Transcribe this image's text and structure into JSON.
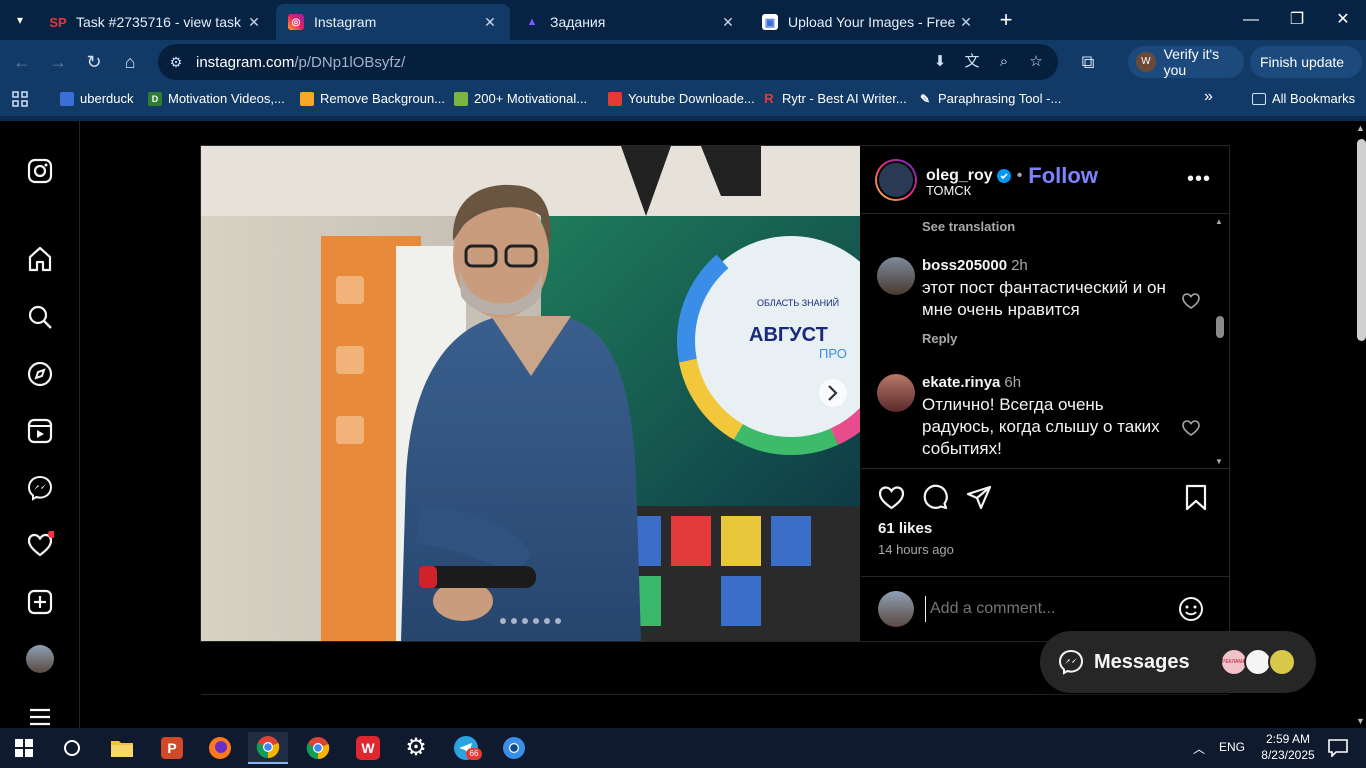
{
  "browser": {
    "tabs": [
      {
        "title": "Task #2735716 - view task",
        "icon": "sp-icon"
      },
      {
        "title": "Instagram",
        "icon": "instagram-icon"
      },
      {
        "title": "Задания",
        "icon": "zadaniya-icon"
      },
      {
        "title": "Upload Your Images - Free Imag",
        "icon": "image-upload-icon"
      }
    ],
    "url_host": "instagram.com",
    "url_path": "/p/DNp1lOBsyfz/",
    "verify_label": "Verify it's you",
    "finish_label": "Finish update"
  },
  "bookmarks": {
    "items": [
      {
        "label": "uberduck",
        "color": "#3b6fd8"
      },
      {
        "label": "Motivation Videos,...",
        "color": "#2e7d32"
      },
      {
        "label": "Remove Backgroun...",
        "color": "#f9a825"
      },
      {
        "label": "200+ Motivational...",
        "color": "#7cb342"
      },
      {
        "label": "Youtube Downloade...",
        "color": "#e53935"
      },
      {
        "label": "Rytr - Best AI Writer...",
        "color": "#e53935"
      },
      {
        "label": "Paraphrasing Tool -...",
        "color": "#ffffff"
      }
    ],
    "all_label": "All Bookmarks"
  },
  "post": {
    "username": "oleg_roy",
    "follow_label": "Follow",
    "separator": "•",
    "location": "ТОМСК",
    "see_translation": "See translation",
    "comments": [
      {
        "user": "boss205000",
        "time": "2h",
        "text": "этот пост фантастический и он мне очень нравится",
        "reply": "Reply"
      },
      {
        "user": "ekate.rinya",
        "time": "6h",
        "text": "Отлично! Всегда очень радуюсь, когда слышу о таких событиях!"
      }
    ],
    "likes": "61 likes",
    "posted": "14 hours ago",
    "comment_placeholder": "Add a comment...",
    "screen_text_1": "АВГУСТ",
    "screen_text_2": "ПРО",
    "screen_text_3": "ОБЛАСТЬ ЗНАНИЙ"
  },
  "messages": {
    "label": "Messages",
    "bubble_text": "РЕКЛАМА"
  },
  "taskbar": {
    "time": "2:59 AM",
    "date": "8/23/2025",
    "lang": "ENG",
    "telegram_badge": "66"
  }
}
